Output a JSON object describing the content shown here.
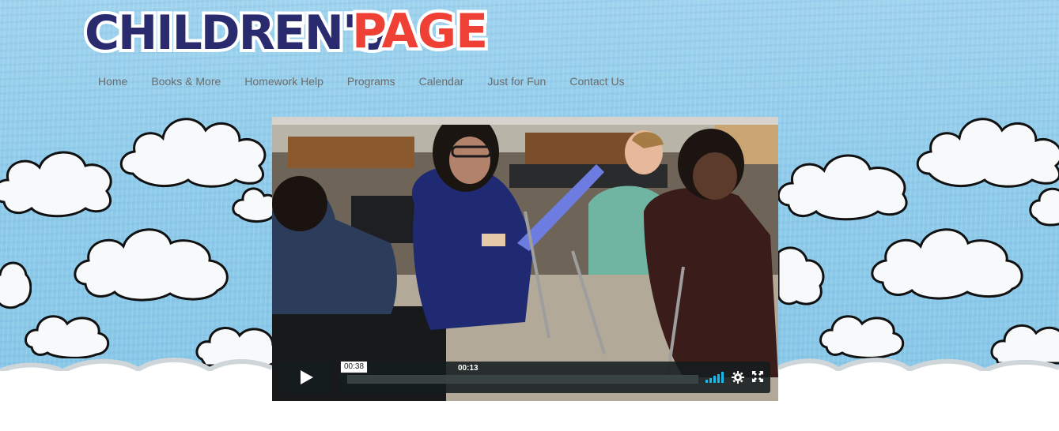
{
  "logo": {
    "part1": "CHILDREN'S",
    "part2": "PAGE"
  },
  "nav": {
    "items": [
      "Home",
      "Books & More",
      "Homework Help",
      "Programs",
      "Calendar",
      "Just for Fun",
      "Contact Us"
    ]
  },
  "video": {
    "hover_time": "00:38",
    "current_time": "00:13",
    "progress": 0.0
  },
  "colors": {
    "sky": "#8fcbe8",
    "logo_primary": "#2a2a6e",
    "logo_accent": "#ef4036",
    "nav_text": "#6b6b6b",
    "volume_accent": "#1ab7ea"
  },
  "icons": [
    "play-icon",
    "volume-icon",
    "settings-gear-icon",
    "fullscreen-icon"
  ]
}
